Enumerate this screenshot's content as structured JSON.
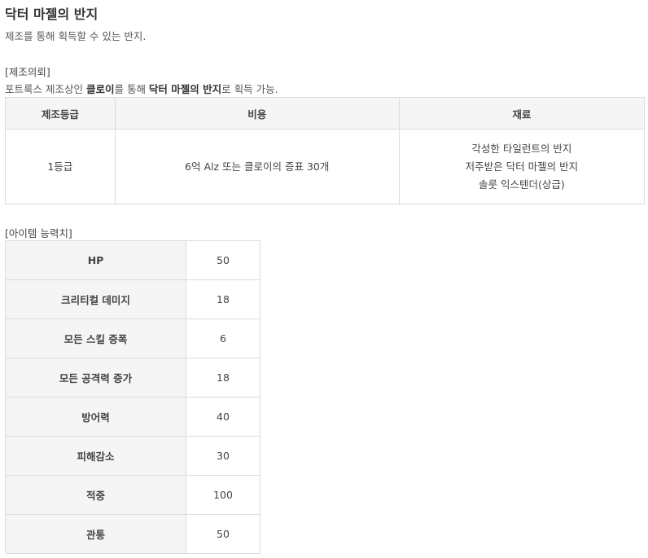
{
  "title": "닥터 마젤의 반지",
  "subtitle": "제조를 통해 획득할 수 있는 반지.",
  "craft_section": {
    "label": "[제조의뢰]",
    "desc_prefix": "포트룩스 제조상인 ",
    "desc_npc": "클로이",
    "desc_mid": "를 통해 ",
    "desc_item": "닥터 마젤의 반지",
    "desc_suffix": "로 획득 가능.",
    "headers": [
      "제조등급",
      "비용",
      "재료"
    ],
    "row": {
      "grade": "1등급",
      "cost": "6억 Alz 또는 클로이의 증표 30개",
      "materials": [
        "각성한 타일런트의 반지",
        "저주받은 닥터 마젤의 반지",
        "솔룻 익스텐더(상급)"
      ]
    }
  },
  "stats_section": {
    "label": "[아이템 능력치]",
    "rows": [
      {
        "name": "HP",
        "value": "50"
      },
      {
        "name": "크리티컬 데미지",
        "value": "18"
      },
      {
        "name": "모든 스킬 증폭",
        "value": "6"
      },
      {
        "name": "모든 공격력 증가",
        "value": "18"
      },
      {
        "name": "방어력",
        "value": "40"
      },
      {
        "name": "피해감소",
        "value": "30"
      },
      {
        "name": "적중",
        "value": "100"
      },
      {
        "name": "관통",
        "value": "50"
      }
    ]
  }
}
